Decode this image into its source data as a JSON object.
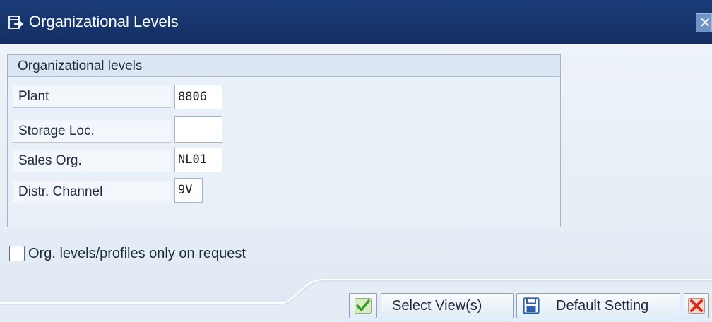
{
  "window": {
    "title": "Organizational Levels",
    "title_icon": "dialog-icon",
    "close_icon": "close-icon",
    "close_glyph": "✕"
  },
  "group": {
    "header": "Organizational levels",
    "rows": [
      {
        "label": "Plant",
        "value": "8806"
      },
      {
        "label": "Storage Loc.",
        "value": ""
      },
      {
        "label": "Sales Org.",
        "value": "NL01"
      },
      {
        "label": "Distr. Channel",
        "value": "9V"
      }
    ]
  },
  "option": {
    "label": "Org. levels/profiles only on request",
    "checked": false
  },
  "footer": {
    "confirm_icon": "checkmark-icon",
    "select_views_label": "Select View(s)",
    "default_setting_icon": "save-icon",
    "default_setting_label": "Default Setting",
    "cancel_icon": "cancel-x-icon"
  },
  "colors": {
    "titlebar": "#142e63",
    "confirm_green": "#3b9b1f",
    "cancel_red": "#d6301c",
    "save_blue": "#2f5fa8"
  }
}
